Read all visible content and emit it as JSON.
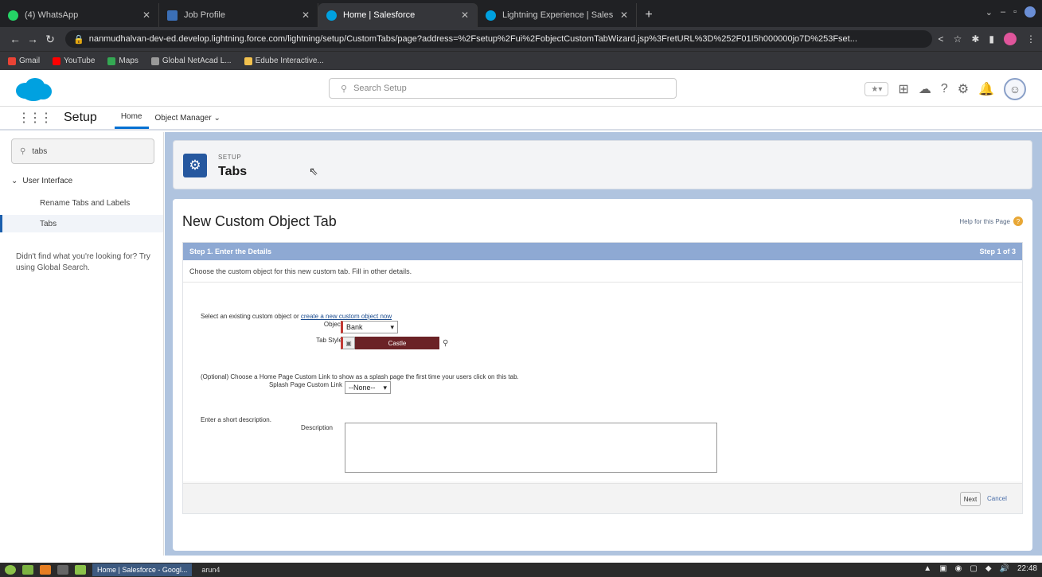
{
  "browser": {
    "tabs": [
      {
        "title": "(4) WhatsApp",
        "color": "#25d366"
      },
      {
        "title": "Job Profile",
        "color": "#3b6fb6"
      },
      {
        "title": "Home | Salesforce",
        "color": "#00a1e0"
      },
      {
        "title": "Lightning Experience | Sales",
        "color": "#00a1e0"
      }
    ],
    "url": "nanmudhalvan-dev-ed.develop.lightning.force.com/lightning/setup/CustomTabs/page?address=%2Fsetup%2Fui%2FobjectCustomTabWizard.jsp%3FretURL%3D%252F01I5h000000jo7D%253Fset...",
    "bookmarks": [
      {
        "label": "Gmail",
        "color": "#ea4335"
      },
      {
        "label": "YouTube",
        "color": "#ff0000"
      },
      {
        "label": "Maps",
        "color": "#34a853"
      },
      {
        "label": "Global NetAcad L...",
        "color": "#999999"
      },
      {
        "label": "Edube Interactive...",
        "color": "#f2c14e"
      }
    ]
  },
  "sf": {
    "search_placeholder": "Search Setup",
    "app_name": "Setup",
    "nav_tabs": [
      "Home",
      "Object Manager"
    ],
    "quick_find_value": "tabs",
    "tree_group": "User Interface",
    "tree_items": [
      "Rename Tabs and Labels",
      "Tabs"
    ],
    "sidebar_note": "Didn't find what you're looking for? Try using Global Search.",
    "header_eyebrow": "SETUP",
    "header_title": "Tabs",
    "page_title": "New Custom Object Tab",
    "help_link": "Help for this Page",
    "step_title": "Step 1. Enter the Details",
    "step_count": "Step 1 of 3",
    "step_desc": "Choose the custom object for this new custom tab. Fill in other details.",
    "select_prompt_prefix": "Select an existing custom object or",
    "select_prompt_link": "create a new custom object now",
    "object_label": "Object",
    "object_value": "Bank",
    "tab_style_label": "Tab Style",
    "tab_style_value": "Castle",
    "optional_prompt": "(Optional) Choose a Home Page Custom Link to show as a splash page the first time your users click on this tab.",
    "splash_label": "Splash Page Custom Link",
    "splash_value": "--None--",
    "desc_prompt": "Enter a short description.",
    "desc_label": "Description",
    "next_label": "Next",
    "cancel_label": "Cancel"
  },
  "taskbar": {
    "active_task": "Home | Salesforce - Googl...",
    "other_task": "arun4",
    "clock": "22:48"
  }
}
